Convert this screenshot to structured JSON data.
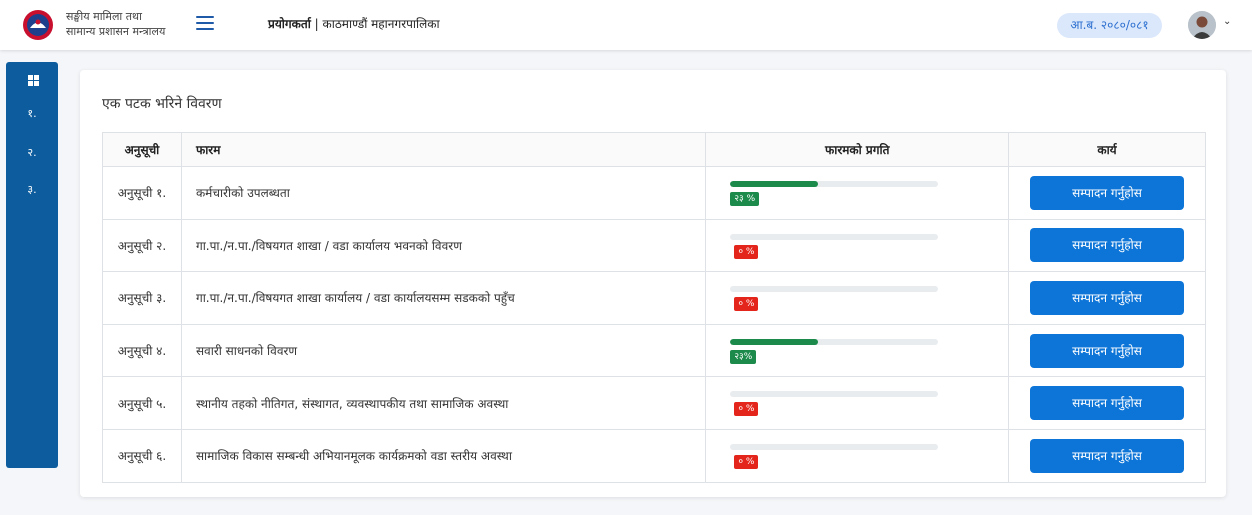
{
  "header": {
    "org_line1": "सङ्घीय मामिला तथा",
    "org_line2": "सामान्य प्रशासन मन्त्रालय",
    "role_label": "प्रयोगकर्ता",
    "role_value": "काठमाण्डौं महानगरपालिका",
    "fiscal_year": "आ.ब. २०८०/०८१"
  },
  "sidebar": {
    "items": [
      {
        "label": "१."
      },
      {
        "label": "२."
      },
      {
        "label": "३."
      }
    ]
  },
  "main": {
    "title": "एक पटक भरिने विवरण",
    "columns": [
      "अनुसूची",
      "फारम",
      "फारमको प्रगति",
      "कार्य"
    ],
    "rows": [
      {
        "schedule": "अनुसूची १.",
        "form": "कर्मचारीको उपलब्धता",
        "progress": 0.42,
        "progress_label": "२३ %",
        "action": "सम्पादन गर्नुहोस"
      },
      {
        "schedule": "अनुसूची २.",
        "form": "गा.पा./न.पा./विषयगत शाखा  / वडा कार्यालय  भवनको विवरण",
        "progress": 0,
        "progress_label": "० %",
        "action": "सम्पादन गर्नुहोस"
      },
      {
        "schedule": "अनुसूची ३.",
        "form": "गा.पा./न.पा./विषयगत शाखा कार्यालय / वडा कार्यालयसम्म सडकको पहुँच",
        "progress": 0,
        "progress_label": "० %",
        "action": "सम्पादन गर्नुहोस"
      },
      {
        "schedule": "अनुसूची ४.",
        "form": "सवारी साधनको विवरण",
        "progress": 0.42,
        "progress_label": "२३%",
        "action": "सम्पादन गर्नुहोस"
      },
      {
        "schedule": "अनुसूची ५.",
        "form": "स्थानीय तहको नीतिगत, संस्थागत, व्यवस्थापकीय तथा सामाजिक अवस्था",
        "progress": 0,
        "progress_label": "० %",
        "action": "सम्पादन गर्नुहोस"
      },
      {
        "schedule": "अनुसूची ६.",
        "form": "सामाजिक विकास सम्बन्धी अभियानमूलक कार्यक्रमको वडा स्तरीय अवस्था",
        "progress": 0,
        "progress_label": "० %",
        "action": "सम्पादन गर्नुहोस"
      }
    ]
  },
  "colors": {
    "accent": "#0d75d8",
    "sidebar": "#0d5d9e",
    "progress_fill": "#1b8a4a",
    "zero_badge": "#e3251b"
  },
  "icons": [
    "emblem-logo",
    "hamburger-menu-icon",
    "avatar",
    "chevron-down-icon",
    "dashboard-icon"
  ]
}
